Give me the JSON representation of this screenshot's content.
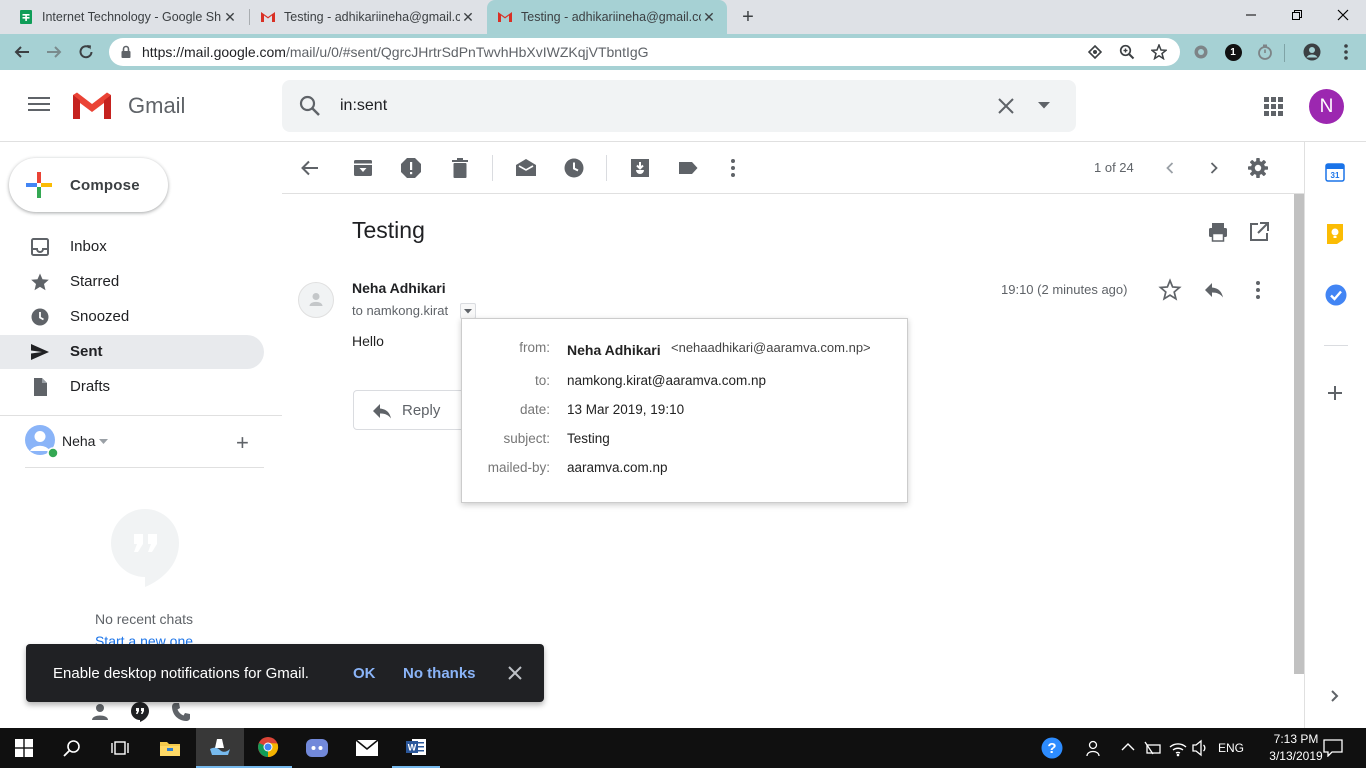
{
  "browser": {
    "tabs": [
      {
        "title": "Internet Technology - Google Sh",
        "icon": "sheets-icon"
      },
      {
        "title": "Testing - adhikariineha@gmail.co",
        "icon": "gmail-icon"
      },
      {
        "title": "Testing - adhikariineha@gmail.co",
        "icon": "gmail-icon"
      }
    ],
    "url_host": "https://mail.google.com",
    "url_path": "/mail/u/0/#sent/QgrcJHrtrSdPnTwvhHbXvIWZKqjVTbntIgG",
    "extension_badge": "1"
  },
  "gmail": {
    "product_name": "Gmail",
    "search_query": "in:sent",
    "avatar_letter": "N",
    "compose_label": "Compose",
    "nav": [
      {
        "label": "Inbox"
      },
      {
        "label": "Starred"
      },
      {
        "label": "Snoozed"
      },
      {
        "label": "Sent"
      },
      {
        "label": "Drafts"
      }
    ],
    "chat_user": "Neha",
    "no_chats": "No recent chats",
    "start_new": "Start a new one",
    "pagination": "1 of 24"
  },
  "message": {
    "subject": "Testing",
    "sender": "Neha Adhikari",
    "to_line": "to namkong.kirat",
    "time": "19:10 (2 minutes ago)",
    "body": "Hello",
    "reply_label": "Reply"
  },
  "details": {
    "from_label": "from:",
    "from_name": "Neha Adhikari",
    "from_email": "<nehaadhikari@aaramva.com.np>",
    "to_label": "to:",
    "to_value": "namkong.kirat@aaramva.com.np",
    "date_label": "date:",
    "date_value": "13 Mar 2019, 19:10",
    "subject_label": "subject:",
    "subject_value": "Testing",
    "mailedby_label": "mailed-by:",
    "mailedby_value": "aaramva.com.np"
  },
  "toast": {
    "message": "Enable desktop notifications for Gmail.",
    "ok": "OK",
    "no_thanks": "No thanks"
  },
  "sidepanel": {
    "calendar_day": "31"
  },
  "taskbar": {
    "language": "ENG",
    "time": "7:13 PM",
    "date": "3/13/2019"
  },
  "colors": {
    "accent_teal": "#a6d1d4",
    "avatar": "#9c27b0",
    "toast_link": "#8ab4f8",
    "gmail_red": "#ea4335"
  }
}
